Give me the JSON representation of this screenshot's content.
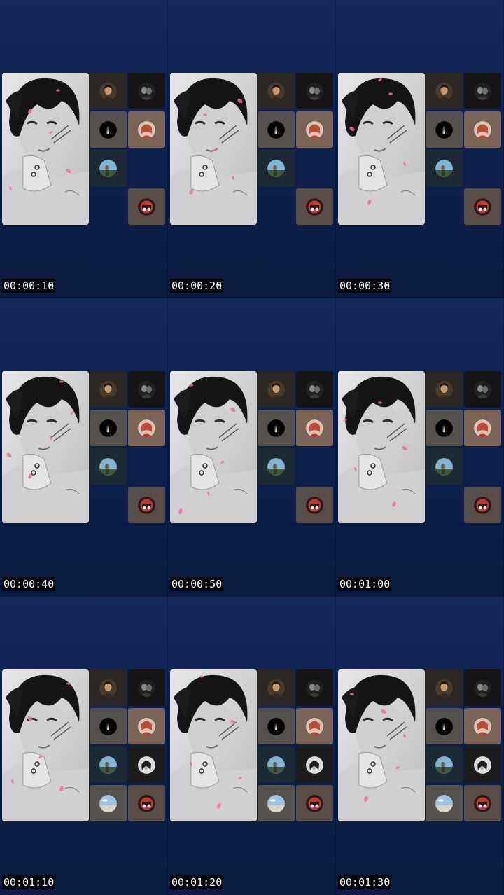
{
  "frames": [
    {
      "timestamp": "00:00:10",
      "tiles": [
        "girl-avatar",
        "couple-avatar",
        "flame-icon",
        "redhair-avatar",
        "field-avatar",
        "",
        "",
        "rider-avatar"
      ]
    },
    {
      "timestamp": "00:00:20",
      "tiles": [
        "girl-avatar",
        "couple-avatar",
        "flame-icon",
        "redhair-avatar",
        "field-avatar",
        "",
        "",
        "rider-avatar"
      ]
    },
    {
      "timestamp": "00:00:30",
      "tiles": [
        "girl-avatar",
        "couple-avatar",
        "flame-icon",
        "redhair-avatar",
        "field-avatar",
        "",
        "",
        "rider-avatar"
      ]
    },
    {
      "timestamp": "00:00:40",
      "tiles": [
        "girl-avatar",
        "couple-avatar",
        "flame-icon",
        "redhair-avatar",
        "field-avatar",
        "",
        "",
        "rider-avatar"
      ]
    },
    {
      "timestamp": "00:00:50",
      "tiles": [
        "girl-avatar",
        "couple-avatar",
        "flame-icon",
        "redhair-avatar",
        "field-avatar",
        "",
        "",
        "rider-avatar"
      ]
    },
    {
      "timestamp": "00:01:00",
      "tiles": [
        "girl-avatar",
        "couple-avatar",
        "flame-icon",
        "redhair-avatar",
        "field-avatar",
        "",
        "",
        "rider-avatar"
      ]
    },
    {
      "timestamp": "00:01:10",
      "tiles": [
        "girl-avatar",
        "couple-avatar",
        "flame-icon",
        "redhair-avatar",
        "field-avatar",
        "bw-portrait-avatar",
        "sky-avatar",
        "rider-avatar"
      ]
    },
    {
      "timestamp": "00:01:20",
      "tiles": [
        "girl-avatar",
        "couple-avatar",
        "flame-icon",
        "redhair-avatar",
        "field-avatar",
        "bw-portrait-avatar",
        "sky-avatar",
        "rider-avatar"
      ]
    },
    {
      "timestamp": "00:01:30",
      "tiles": [
        "girl-avatar",
        "couple-avatar",
        "flame-icon",
        "redhair-avatar",
        "field-avatar",
        "bw-portrait-avatar",
        "sky-avatar",
        "rider-avatar"
      ]
    }
  ],
  "colors": {
    "background_top": "#13295a",
    "background_bottom": "#0b1a40",
    "timestamp_bg": "#000000",
    "timestamp_text": "#ffffff",
    "petal": "#f0738c"
  }
}
